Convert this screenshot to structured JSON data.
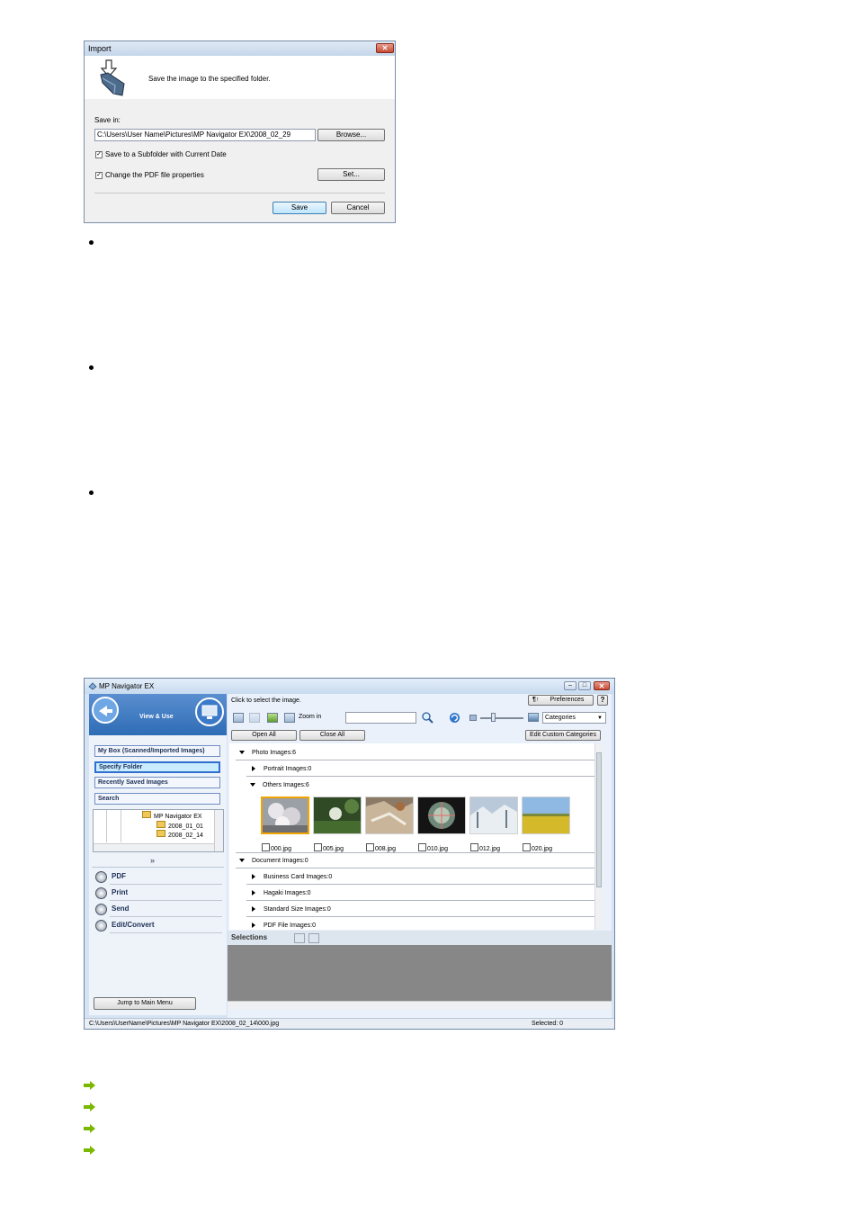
{
  "import_dialog": {
    "title": "Import",
    "message": "Save the image to the specified folder.",
    "save_in_label": "Save in:",
    "save_in_path": "C:\\Users\\User Name\\Pictures\\MP Navigator EX\\2008_02_29",
    "browse_button": "Browse...",
    "subfolder_checkbox": "Save to a Subfolder with Current Date",
    "pdf_properties_checkbox": "Change the PDF file properties",
    "set_button": "Set...",
    "save_button": "Save",
    "cancel_button": "Cancel",
    "close_glyph": "✕"
  },
  "mp_navigator": {
    "title": "MP Navigator EX",
    "mode_label": "View & Use",
    "nav_items": [
      "My Box (Scanned/Imported Images)",
      "Specify Folder",
      "Recently Saved Images",
      "Search"
    ],
    "folder_tree": {
      "root": "MP Navigator EX",
      "children": [
        "2008_01_01",
        "2008_02_14"
      ]
    },
    "expand_glyph": "»",
    "tasks": [
      "PDF",
      "Print",
      "Send",
      "Edit/Convert"
    ],
    "jump_button": "Jump to Main Menu",
    "instruction": "Click to select the image.",
    "preferences_button": "Preferences",
    "help_button": "?",
    "zoom_in_label": "Zoom in",
    "categories_select": "Categories",
    "open_all_button": "Open All",
    "close_all_button": "Close All",
    "edit_custom_categories_button": "Edit Custom Categories",
    "groups": {
      "photo": "Photo    Images:6",
      "portrait": "Portrait    Images:0",
      "others": "Others    Images:6",
      "document": "Document    Images:0",
      "business_card": "Business Card    Images:0",
      "hagaki": "Hagaki    Images:0",
      "standard_size": "Standard Size    Images:0",
      "pdf_file": "PDF File    Images:0"
    },
    "thumbnails": [
      "000.jpg",
      "005.jpg",
      "008.jpg",
      "010.jpg",
      "012.jpg",
      "020.jpg"
    ],
    "selections_label": "Selections",
    "status_path": "C:\\Users\\UserName\\Pictures\\MP Navigator EX\\2008_02_14\\000.jpg",
    "status_selected": "Selected: 0"
  },
  "icons": [
    "import-folder-icon",
    "app-icon",
    "view-use-icon",
    "preferences-icon",
    "zoom-icon",
    "refresh-icon",
    "pdf-icon",
    "print-icon",
    "send-icon",
    "edit-convert-icon",
    "arrow-link-icon"
  ],
  "colors": {
    "link_arrow": "#7ab800",
    "selection": "#f2a400",
    "nav_blue": "#2e6cb5"
  }
}
